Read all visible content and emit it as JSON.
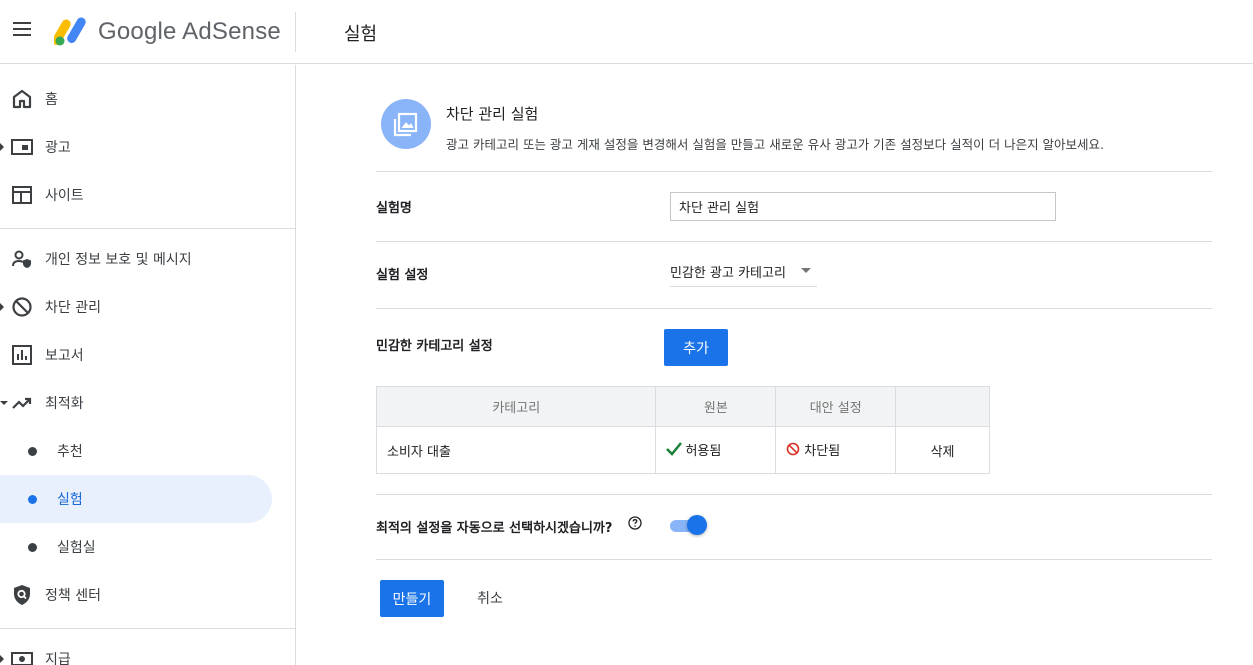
{
  "header": {
    "logo_text": "Google AdSense",
    "page_title": "실험"
  },
  "sidebar": {
    "items": [
      {
        "label": "홈",
        "icon": "home-icon"
      },
      {
        "label": "광고",
        "icon": "ads-icon"
      },
      {
        "label": "사이트",
        "icon": "sites-icon"
      },
      {
        "label": "개인 정보 보호 및 메시지",
        "icon": "privacy-icon"
      },
      {
        "label": "차단 관리",
        "icon": "block-icon"
      },
      {
        "label": "보고서",
        "icon": "reports-icon"
      },
      {
        "label": "최적화",
        "icon": "optimization-icon"
      },
      {
        "label": "정책 센터",
        "icon": "policy-icon"
      },
      {
        "label": "지급",
        "icon": "payments-icon"
      }
    ],
    "sub_items": [
      {
        "label": "추천"
      },
      {
        "label": "실험",
        "active": true
      },
      {
        "label": "실험실"
      }
    ]
  },
  "experiment": {
    "title": "차단 관리 실험",
    "description": "광고 카테고리 또는 광고 게재 설정을 변경해서 실험을 만들고 새로운 유사 광고가 기존 설정보다 실적이 더 나은지 알아보세요."
  },
  "form": {
    "name_label": "실험명",
    "name_value": "차단 관리 실험",
    "settings_label": "실험 설정",
    "settings_value": "민감한 광고 카테고리",
    "sensitive_label": "민감한 카테고리 설정",
    "add_button": "추가",
    "auto_select_label": "최적의 설정을 자동으로 선택하시겠습니까?",
    "auto_select_enabled": true,
    "create_button": "만들기",
    "cancel_button": "취소"
  },
  "table": {
    "headers": [
      "카테고리",
      "원본",
      "대안 설정",
      ""
    ],
    "rows": [
      {
        "category": "소비자 대출",
        "original": "허용됨",
        "alternative": "차단됨",
        "action": "삭제"
      }
    ]
  },
  "colors": {
    "accent": "#1a73e8",
    "allowed": "#188038",
    "blocked": "#d93025"
  }
}
